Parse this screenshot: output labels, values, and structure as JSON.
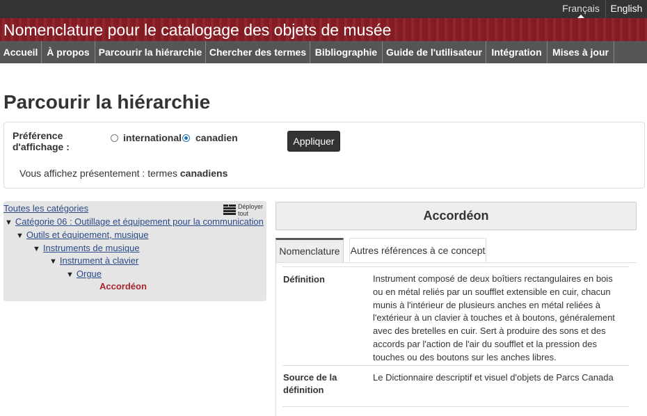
{
  "languages": {
    "francais": "Français",
    "english": "English"
  },
  "banner": {
    "title": "Nomenclature pour le catalogage des objets de musée"
  },
  "menu": [
    "Accueil",
    "À propos",
    "Parcourir la hiérarchie",
    "Chercher des termes",
    "Bibliographie",
    "Guide de l'utilisateur",
    "Intégration",
    "Mises à jour"
  ],
  "page": {
    "title": "Parcourir la hiérarchie"
  },
  "preference": {
    "label": "Préférence d'affichage :",
    "option_international": "international",
    "option_canadien": "canadien",
    "selected": "canadien",
    "apply": "Appliquer",
    "status_prefix": "Vous affichez présentement : termes ",
    "status_value": "canadiens"
  },
  "tree": {
    "root": "Toutes les catégories",
    "expand_all": "Déployer tout",
    "levels": [
      "Catégorie 06 : Outillage et équipement pour la communication",
      "Outils et équipement, musique",
      "Instruments de musique",
      "Instrument à clavier",
      "Orgue"
    ],
    "current": "Accordéon",
    "triangle": "▼"
  },
  "detail": {
    "term": "Accordéon",
    "tabs": [
      "Nomenclature",
      "Autres références à ce concept"
    ],
    "definition_label": "Définition",
    "definition_lines": [
      "Instrument composé de deux boîtiers rectangulaires en bois",
      "ou en métal reliés par un soufflet extensible en cuir, chacun",
      "munis à l'intérieur de plusieurs anches en métal reliées à",
      "l'extérieur à un clavier à touches et à boutons, généralement",
      "avec des bretelles en cuir. Sert à produire des sons et des",
      "accords par l'action de l'air du soufflet et la pression des",
      "touches ou des boutons sur les anches libres."
    ],
    "source_label_lines": [
      "Source de la",
      "définition"
    ],
    "source_value": "Le Dictionnaire descriptif et visuel d'objets de Parcs Canada"
  },
  "colors": {
    "banner": "#8b1e25",
    "menu": "#555555",
    "link": "#2b4a8a",
    "current_term": "#a8232c",
    "radio_checked": "#2572b4"
  }
}
